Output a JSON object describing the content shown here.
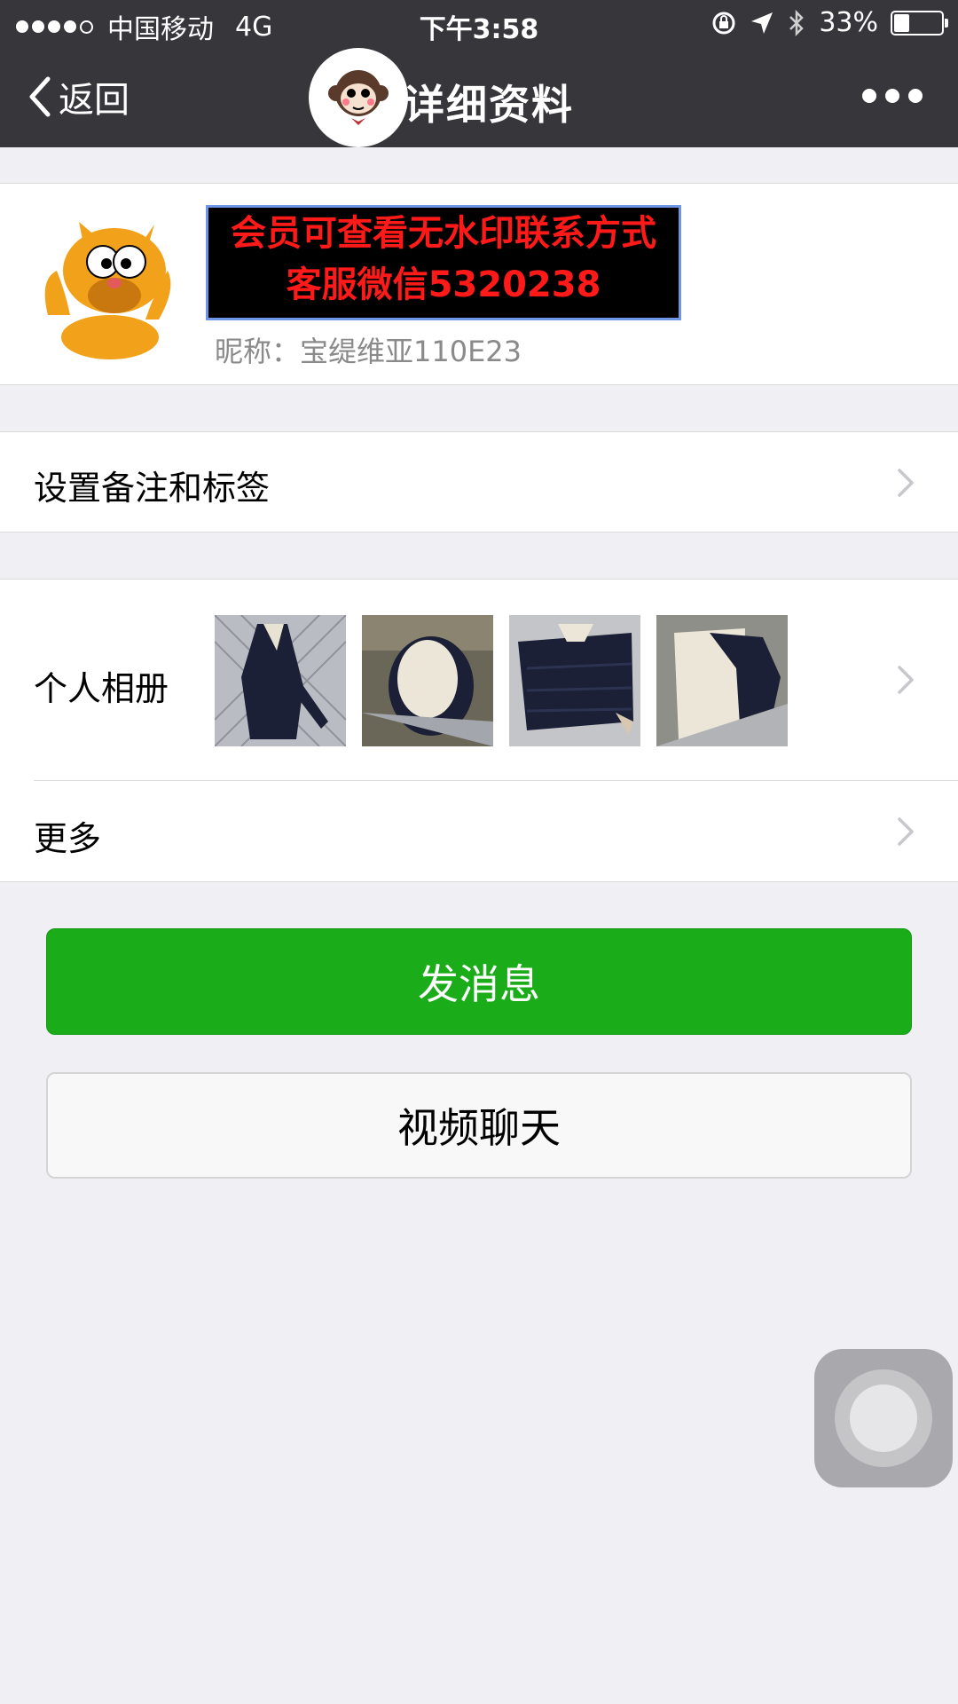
{
  "status_bar": {
    "carrier": "中国移动",
    "network": "4G",
    "time": "下午3:58",
    "battery": "33%",
    "battery_level": 0.33,
    "icons": [
      "signal-icon",
      "lock-rotation-icon",
      "location-icon",
      "bluetooth-icon",
      "battery-icon"
    ]
  },
  "navbar": {
    "back_label": "返回",
    "title": "详细资料",
    "more_icon": "ellipsis-icon"
  },
  "profile": {
    "watermark_line1": "会员可查看无水印联系方式",
    "watermark_line2": "客服微信5320238",
    "nickname": "昵称：宝缇维亚110E23"
  },
  "cells": {
    "remark_label": "设置备注和标签",
    "album_label": "个人相册",
    "more_label": "更多"
  },
  "buttons": {
    "send_message": "发消息",
    "video_chat": "视频聊天"
  },
  "colors": {
    "bar": "#37363b",
    "primary_green": "#1aad19",
    "background": "#efeff4",
    "watermark_text": "#ff1a1a"
  }
}
